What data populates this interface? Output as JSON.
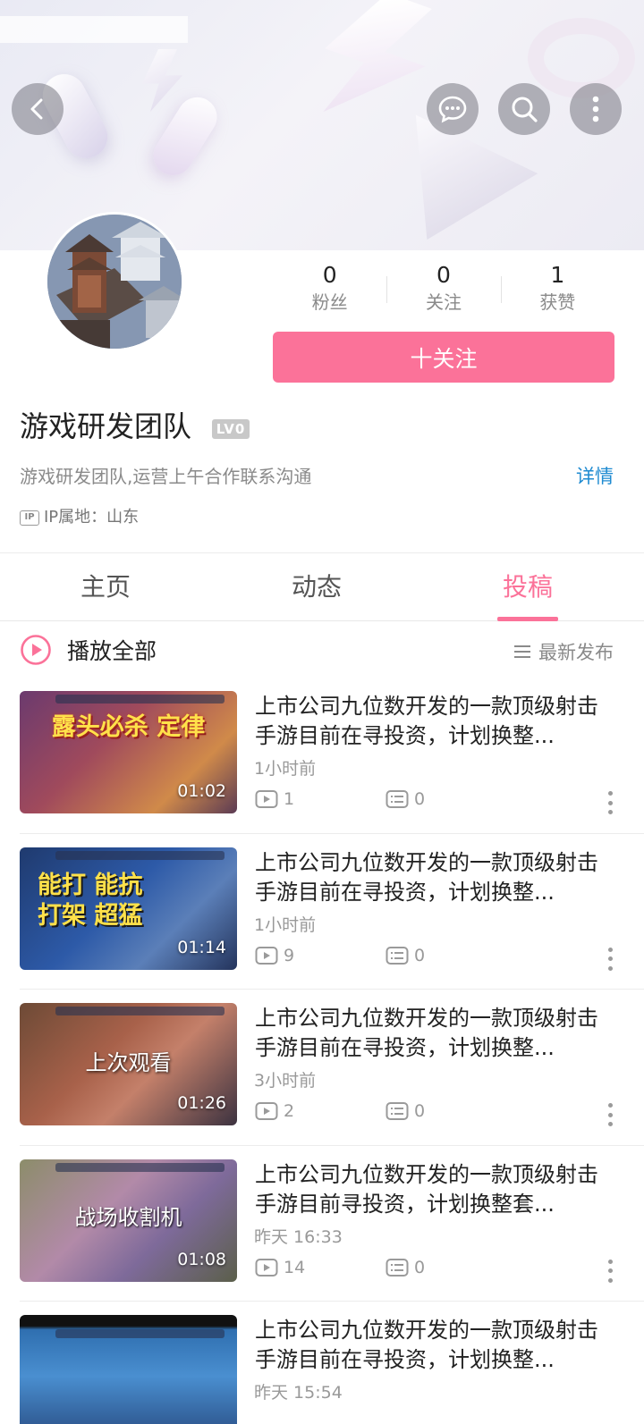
{
  "header": {
    "back_icon": "chevron-left-icon",
    "message_icon": "chat-bubble-icon",
    "search_icon": "search-icon",
    "more_icon": "more-vertical-icon"
  },
  "profile": {
    "name": "游戏研发团队",
    "level": "LV0",
    "bio": "游戏研发团队,运营上午合作联系沟通",
    "detail_link": "详情",
    "ip_badge": "IP",
    "ip_location": "IP属地：山东",
    "stats": [
      {
        "value": "0",
        "label": "粉丝"
      },
      {
        "value": "0",
        "label": "关注"
      },
      {
        "value": "1",
        "label": "获赞"
      }
    ],
    "follow_button": "十关注"
  },
  "tabs": [
    {
      "label": "主页",
      "active": false
    },
    {
      "label": "动态",
      "active": false
    },
    {
      "label": "投稿",
      "active": true
    }
  ],
  "toolbar": {
    "play_all": "播放全部",
    "sort": "最新发布"
  },
  "videos": [
    {
      "title": "上市公司九位数开发的一款顶级射击手游目前在寻投资，计划换整...",
      "time": "1小时前",
      "plays": "1",
      "danmaku": "0",
      "duration": "01:02",
      "thumb_caption": "露头必杀 定律"
    },
    {
      "title": "上市公司九位数开发的一款顶级射击手游目前在寻投资，计划换整...",
      "time": "1小时前",
      "plays": "9",
      "danmaku": "0",
      "duration": "01:14",
      "thumb_caption": "能打 能抗 打架 超猛"
    },
    {
      "title": "上市公司九位数开发的一款顶级射击手游目前在寻投资，计划换整...",
      "time": "3小时前",
      "plays": "2",
      "danmaku": "0",
      "duration": "01:26",
      "thumb_caption": "上次观看"
    },
    {
      "title": "上市公司九位数开发的一款顶级射击手游目前寻投资，计划换整套...",
      "time": "昨天 16:33",
      "plays": "14",
      "danmaku": "0",
      "duration": "01:08",
      "thumb_caption": "战场收割机"
    },
    {
      "title": "上市公司九位数开发的一款顶级射击手游目前在寻投资，计划换整...",
      "time": "昨天 15:54",
      "plays": "",
      "danmaku": "",
      "duration": "",
      "thumb_caption": ""
    }
  ],
  "colors": {
    "accent": "#fb7299",
    "link": "#1f8bd1",
    "muted": "#999999"
  }
}
